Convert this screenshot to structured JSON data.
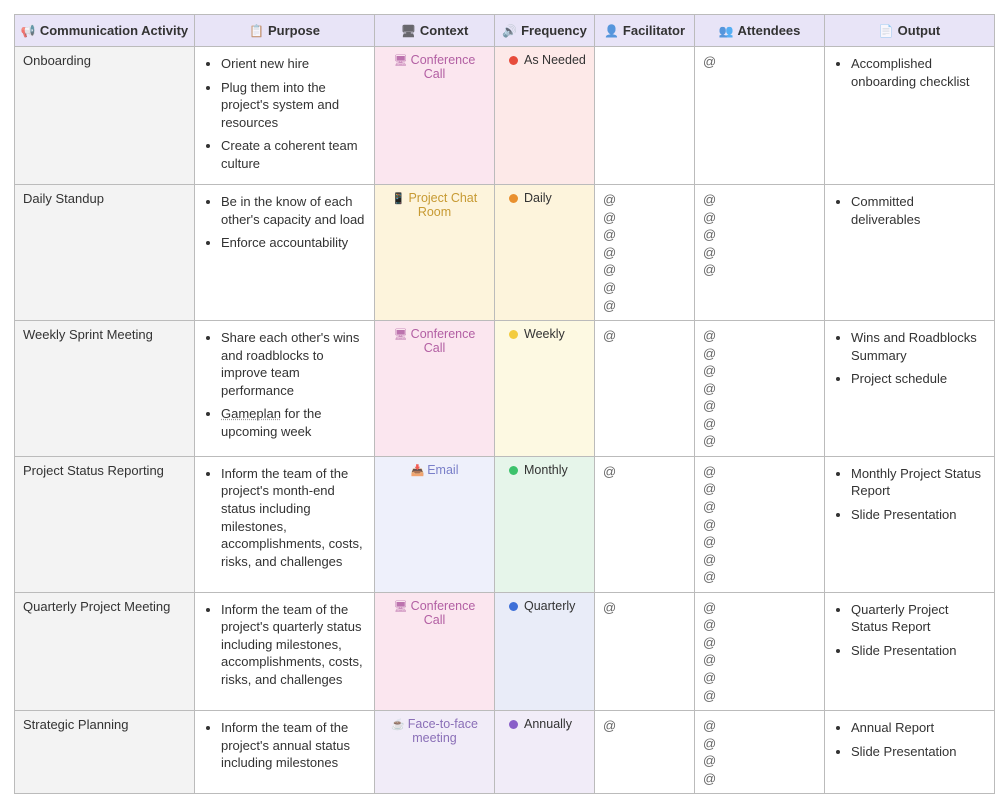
{
  "headers": {
    "activity": "Communication Activity",
    "purpose": "Purpose",
    "context": "Context",
    "frequency": "Frequency",
    "facilitator": "Facilitator",
    "attendees": "Attendees",
    "output": "Output"
  },
  "header_icons": {
    "activity": "📢",
    "purpose": "📋",
    "context": "🖥",
    "frequency": "🔊",
    "facilitator": "👤",
    "attendees": "👥",
    "output": "📄"
  },
  "context_labels": {
    "confcall": "Conference Call",
    "chat": "Project Chat Room",
    "email": "Email",
    "f2f": "Face-to-face meeting"
  },
  "context_icons": {
    "confcall": "🖥",
    "chat": "📱",
    "email": "📥",
    "f2f": "☕"
  },
  "frequency_labels": {
    "asneeded": "As Needed",
    "daily": "Daily",
    "weekly": "Weekly",
    "monthly": "Monthly",
    "quarterly": "Quarterly",
    "annually": "Annually"
  },
  "at_symbol": "@",
  "rows": [
    {
      "activity": "Onboarding",
      "purpose": [
        "Orient new hire",
        "Plug them into the project's system and resources",
        "Create a coherent team culture"
      ],
      "context": "confcall",
      "frequency": "asneeded",
      "facilitator_count": 0,
      "attendees_count": 1,
      "output": [
        "Accomplished onboarding checklist"
      ]
    },
    {
      "activity": "Daily Standup",
      "purpose": [
        "Be in the know of each other's capacity and load",
        "Enforce accountability"
      ],
      "context": "chat",
      "frequency": "daily",
      "facilitator_count": 7,
      "attendees_count": 5,
      "output": [
        "Committed deliverables"
      ]
    },
    {
      "activity": "Weekly Sprint Meeting",
      "purpose": [
        "Share each other's wins and roadblocks to improve team performance",
        "__UL__Gameplan__ for the upcoming week"
      ],
      "context": "confcall",
      "frequency": "weekly",
      "facilitator_count": 1,
      "attendees_count": 7,
      "output": [
        "Wins and Roadblocks Summary",
        "Project schedule"
      ]
    },
    {
      "activity": "Project Status Reporting",
      "purpose": [
        "Inform the team of the project's month-end status including milestones, accomplishments, costs, risks, and challenges"
      ],
      "context": "email",
      "frequency": "monthly",
      "facilitator_count": 1,
      "attendees_count": 7,
      "output": [
        "Monthly Project Status Report",
        "Slide Presentation"
      ]
    },
    {
      "activity": "Quarterly Project Meeting",
      "purpose": [
        "Inform the team of the project's quarterly status including milestones, accomplishments, costs, risks, and challenges"
      ],
      "context": "confcall",
      "frequency": "quarterly",
      "facilitator_count": 1,
      "attendees_count": 6,
      "output": [
        "Quarterly Project Status Report",
        "Slide Presentation"
      ]
    },
    {
      "activity": "Strategic Planning",
      "purpose": [
        "Inform the team of the project's annual status including milestones"
      ],
      "context": "f2f",
      "frequency": "annually",
      "facilitator_count": 1,
      "attendees_count": 4,
      "output": [
        "Annual Report",
        "Slide Presentation"
      ]
    }
  ]
}
